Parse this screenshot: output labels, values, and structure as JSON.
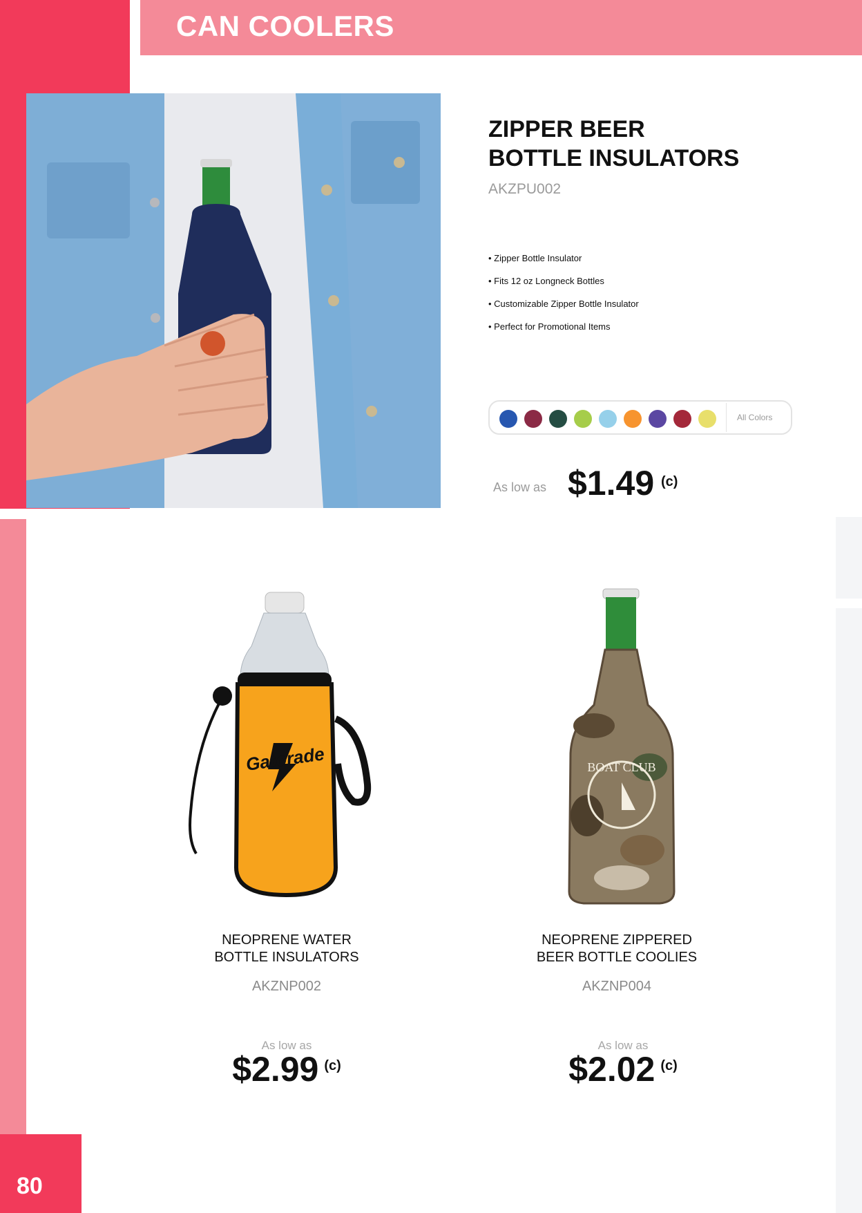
{
  "header": {
    "title": "CAN COOLERS"
  },
  "page_number": "80",
  "featured": {
    "title_line1": "ZIPPER BEER",
    "title_line2": "BOTTLE INSULATORS",
    "sku": "AKZPU002",
    "features": [
      "Zipper Bottle Insulator",
      "Fits 12 oz Longneck Bottles",
      "Customizable Zipper Bottle Insulator",
      "Perfect for Promotional Items"
    ],
    "colors": [
      "#2757b0",
      "#8b2a45",
      "#254d43",
      "#a6cd4a",
      "#96d0ea",
      "#f7942f",
      "#5b47a2",
      "#a4283a",
      "#e8df6b"
    ],
    "all_colors_label": "All Colors",
    "as_low_as": "As low as",
    "price": "$1.49",
    "price_code": "(c)"
  },
  "products": [
    {
      "name_line1": "NEOPRENE WATER",
      "name_line2": "BOTTLE INSULATORS",
      "sku": "AKZNP002",
      "as_low_as": "As low as",
      "price": "$2.99",
      "price_code": "(c)",
      "imprint_text": "Gatorade"
    },
    {
      "name_line1": "NEOPRENE ZIPPERED",
      "name_line2": "BEER BOTTLE COOLIES",
      "sku": "AKZNP004",
      "as_low_as": "As low as",
      "price": "$2.02",
      "price_code": "(c)",
      "imprint_text": "BOAT CLUB"
    }
  ]
}
